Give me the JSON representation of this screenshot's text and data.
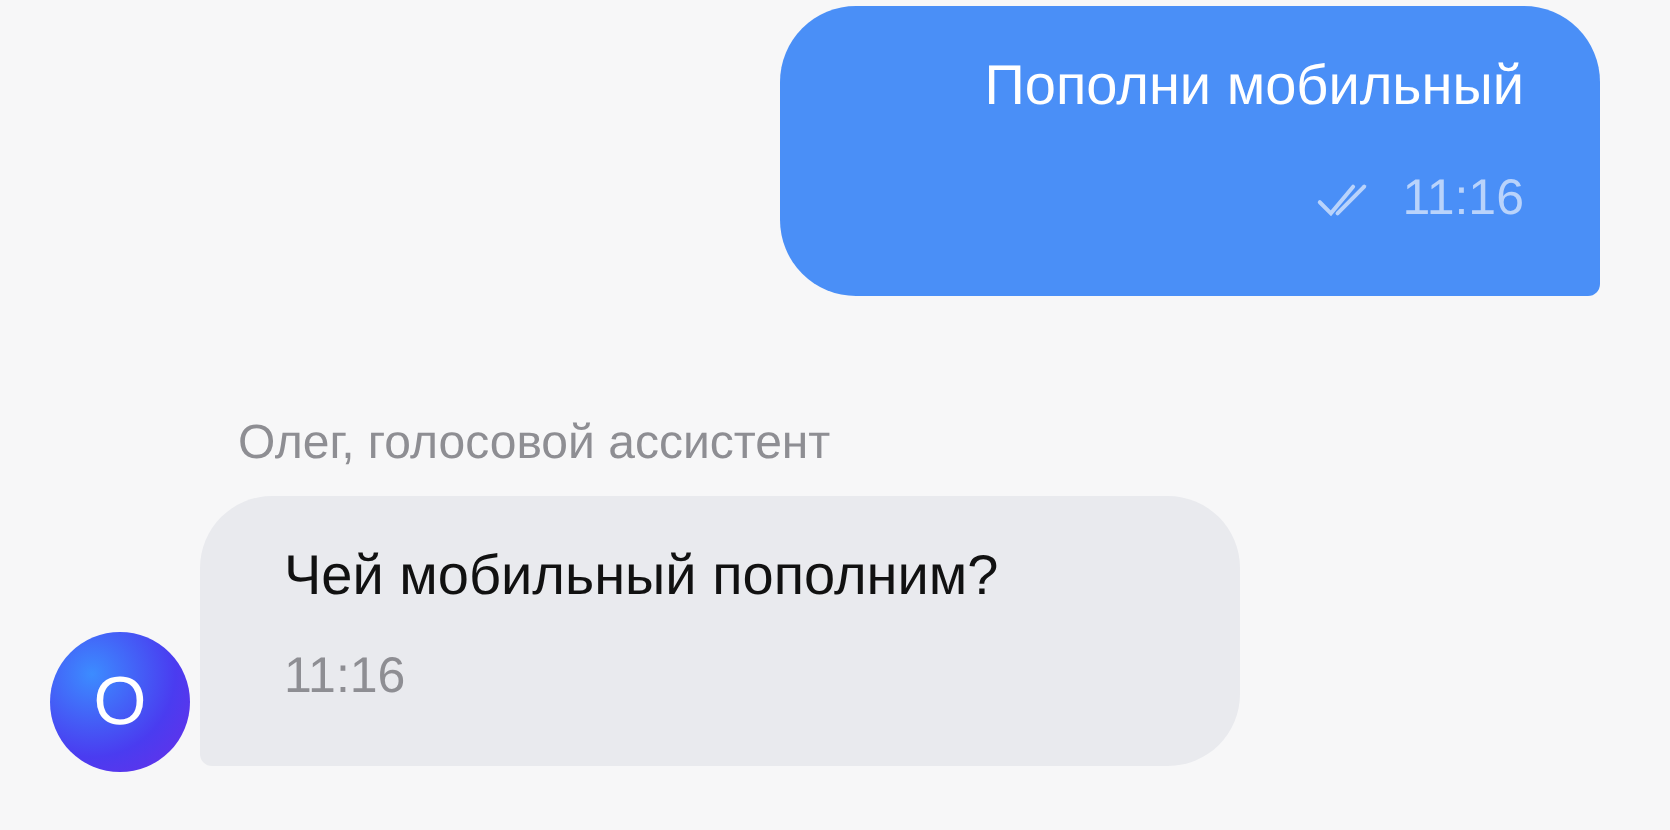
{
  "messages": [
    {
      "kind": "outgoing",
      "text": "Пополни мобильный",
      "time": "11:16",
      "read": true
    },
    {
      "kind": "incoming",
      "sender": "Олег, голосовой ассистент",
      "avatar": "О",
      "text": "Чей мобильный пополним?",
      "time": "11:16"
    }
  ]
}
